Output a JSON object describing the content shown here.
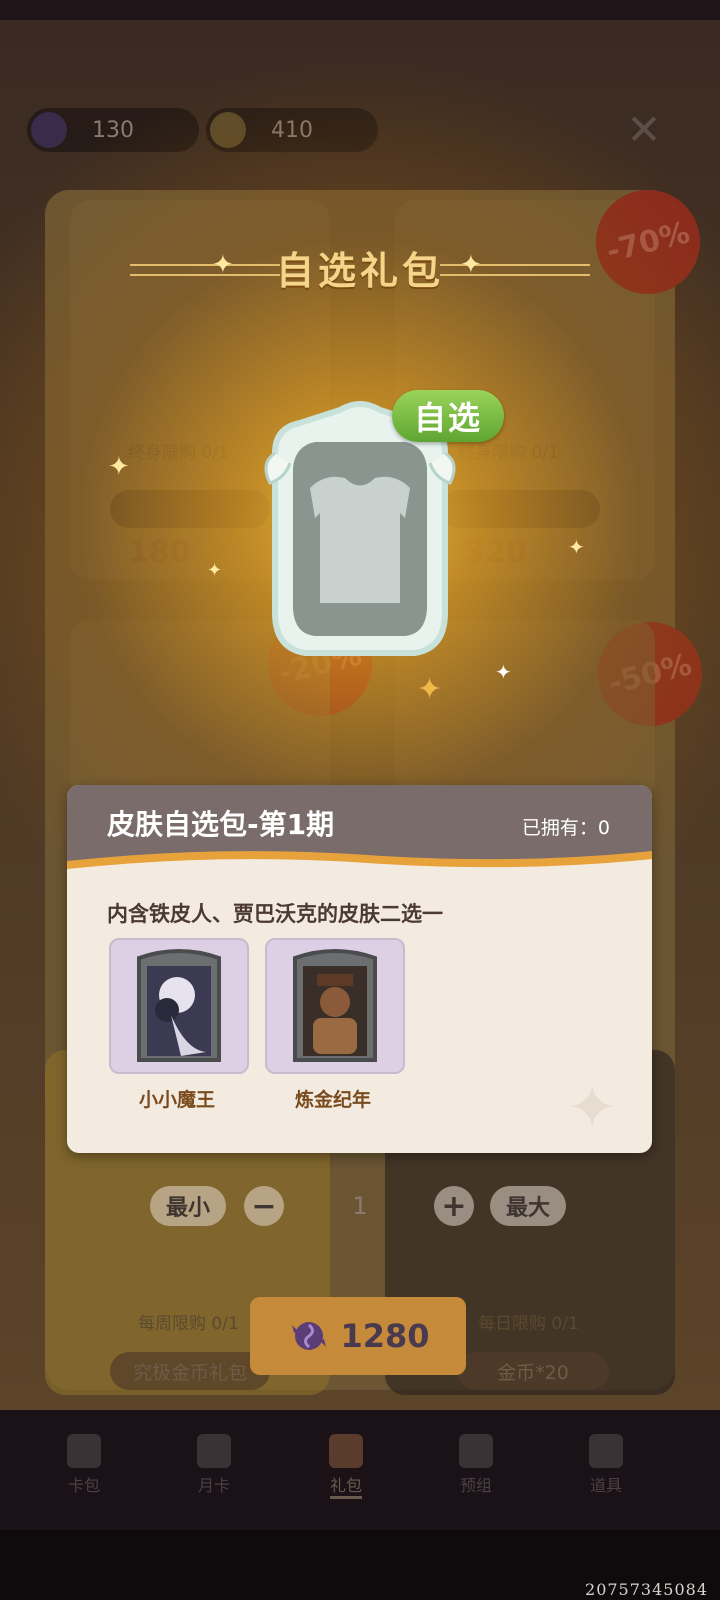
{
  "currencies": [
    {
      "icon": "candy-currency-icon",
      "amount": "130"
    },
    {
      "icon": "gold-coin-icon",
      "amount": "410"
    }
  ],
  "background_shop": {
    "cards": [
      {
        "limit": "终身限购 0/1",
        "price": "180"
      },
      {
        "limit": "终身限购 0/1",
        "price": "320",
        "discount": "-70%"
      },
      {
        "discount": "-20%"
      },
      {
        "discount": "-50%"
      },
      {
        "limit": "每周限购 0/1",
        "name": "究极金币礼包"
      },
      {
        "limit": "每日限购 0/1",
        "name": "金币*20"
      }
    ]
  },
  "popup": {
    "title": "自选礼包",
    "badge": "自选",
    "pack_name": "皮肤自选包-第1期",
    "owned": "已拥有：0",
    "description": "内含铁皮人、贾巴沃克的皮肤二选一",
    "skins": [
      {
        "name": "小小魔王",
        "icon": "demon-character-portrait"
      },
      {
        "name": "炼金纪年",
        "icon": "alchemist-character-portrait"
      }
    ],
    "quantity": {
      "min_label": "最小",
      "value": "1",
      "max_label": "最大"
    },
    "buy": {
      "price": "1280",
      "icon": "candy-currency-icon"
    }
  },
  "nav": [
    {
      "label": "卡包",
      "icon": "card-pack-icon"
    },
    {
      "label": "月卡",
      "icon": "monthly-card-icon"
    },
    {
      "label": "礼包",
      "icon": "gift-icon",
      "active": true
    },
    {
      "label": "预组",
      "icon": "deck-icon"
    },
    {
      "label": "道具",
      "icon": "item-icon"
    }
  ],
  "footer_id": "20757345084",
  "colors": {
    "accent_gold": "#f4d58a",
    "badge_green": "#7cc043",
    "buy_button": "#c68a3b"
  }
}
